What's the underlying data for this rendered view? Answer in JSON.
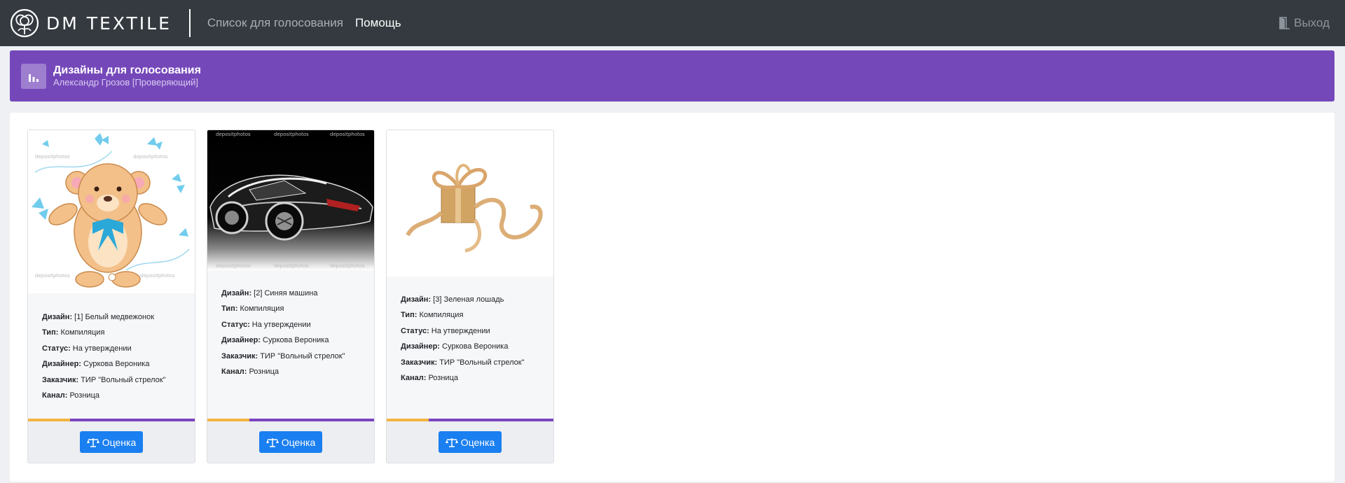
{
  "navbar": {
    "brand": "DM TEXTILE",
    "links": [
      "Список для голосования",
      "Помощь"
    ],
    "logout_label": "Выход",
    "logo_icon": "cotton-flower-icon",
    "logout_icon": "door-exit-icon"
  },
  "header": {
    "title": "Дизайны для голосования",
    "subtitle": "Александр Грозов [Проверяющий]",
    "icon": "bar-chart-icon",
    "color": "#7548ba"
  },
  "cards": [
    {
      "image": "teddy-bear-with-butterflies",
      "rows": [
        {
          "label": "Дизайн:",
          "value": "[1] Белый медвежонок"
        },
        {
          "label": "Тип:",
          "value": "Компиляция"
        },
        {
          "label": "Статус:",
          "value": "На утверждении"
        },
        {
          "label": "Дизайнер:",
          "value": "Суркова Вероника"
        },
        {
          "label": "Заказчик:",
          "value": "ТИР \"Вольный стрелок\""
        },
        {
          "label": "Канал:",
          "value": "Розница"
        }
      ],
      "button_label": "Оценка"
    },
    {
      "image": "black-sports-car",
      "rows": [
        {
          "label": "Дизайн:",
          "value": "[2] Синяя машина"
        },
        {
          "label": "Тип:",
          "value": "Компиляция"
        },
        {
          "label": "Статус:",
          "value": "На утверждении"
        },
        {
          "label": "Дизайнер:",
          "value": "Суркова Вероника"
        },
        {
          "label": "Заказчик:",
          "value": "ТИР \"Вольный стрелок\""
        },
        {
          "label": "Канал:",
          "value": "Розница"
        }
      ],
      "button_label": "Оценка"
    },
    {
      "image": "gold-gift-box-with-ribbon",
      "rows": [
        {
          "label": "Дизайн:",
          "value": "[3] Зеленая лошадь"
        },
        {
          "label": "Тип:",
          "value": "Компиляция"
        },
        {
          "label": "Статус:",
          "value": "На утверждении"
        },
        {
          "label": "Дизайнер:",
          "value": "Суркова Вероника"
        },
        {
          "label": "Заказчик:",
          "value": "ТИР \"Вольный стрелок\""
        },
        {
          "label": "Канал:",
          "value": "Розница"
        }
      ],
      "button_label": "Оценка"
    }
  ],
  "colors": {
    "navbar": "#343a40",
    "accent": "#7548ba",
    "button": "#1a7ff0",
    "progress_a": "#f2b541",
    "progress_b": "#7a45bf"
  }
}
